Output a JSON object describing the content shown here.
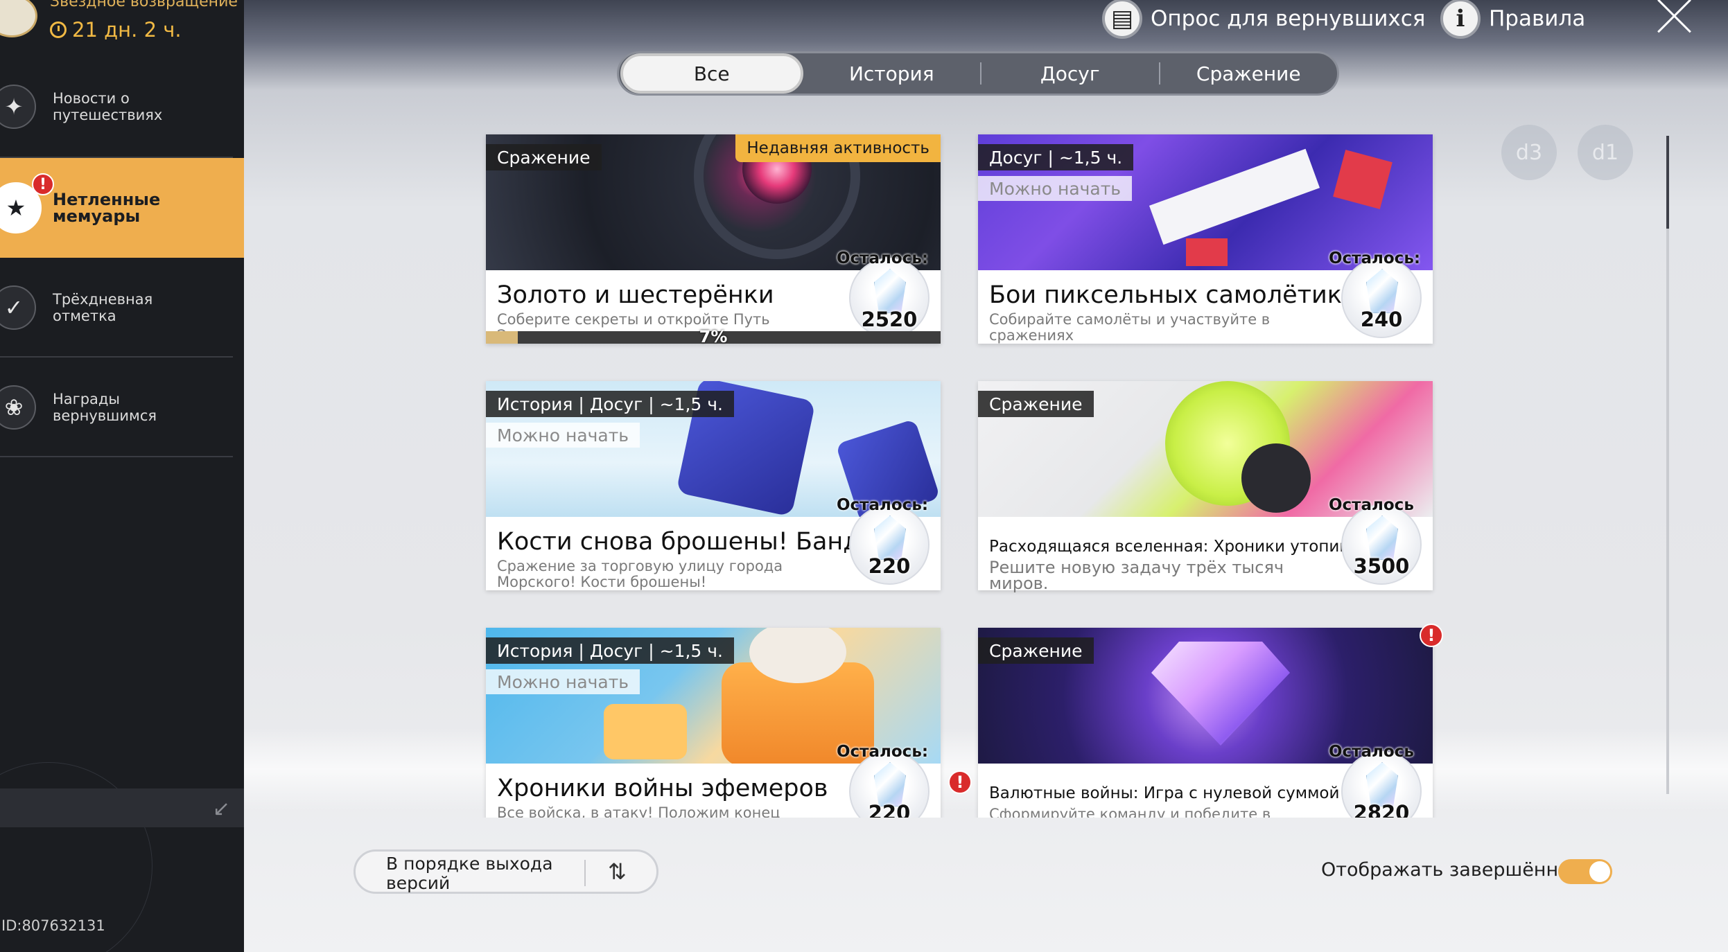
{
  "sidebar": {
    "event_title": "Звездное возвращение",
    "timer": "21 дн. 2 ч.",
    "items": [
      {
        "label": "Новости о путешествиях"
      },
      {
        "label": "Нетленные мемуары",
        "active": true
      },
      {
        "label": "Трёхдневная отметка"
      },
      {
        "label": "Награды вернувшимся"
      }
    ],
    "user_id": "ID:807632131"
  },
  "topbar": {
    "survey_label": "Опрос для вернувшихся",
    "rules_label": "Правила"
  },
  "tabs": [
    {
      "label": "Все",
      "selected": true
    },
    {
      "label": "История"
    },
    {
      "label": "Досуг"
    },
    {
      "label": "Сражение"
    }
  ],
  "cards": [
    {
      "tag": "Сражение",
      "recent": "Недавняя активность",
      "title": "Золото и шестерёнки",
      "desc": "Соберите секреты и откройте Путь Эрудиции.",
      "remain_label": "Осталось:",
      "amount": "2520",
      "progress_text": "7%",
      "progress": 0.07
    },
    {
      "tag": "Досуг | ~1,5 ч.",
      "status": "Можно начать",
      "title": "Бои пиксельных самолётиков",
      "desc": "Собирайте самолёты и участвуйте в сражениях",
      "remain_label": "Осталось:",
      "amount": "240"
    },
    {
      "tag": "История | Досуг | ~1,5 ч.",
      "status": "Можно начать",
      "title": "Кости снова брошены! Банда!",
      "desc": "Сражение за торговую улицу города Морского! Кости брошены!",
      "remain_label": "Осталось:",
      "amount": "220"
    },
    {
      "tag": "Сражение",
      "title": "Расходящаяся вселенная: Хроники утопии",
      "desc": "Решите новую задачу трёх тысяч миров.",
      "remain_label": "Осталось",
      "amount": "3500"
    },
    {
      "tag": "История | Досуг | ~1,5 ч.",
      "status": "Можно начать",
      "title": "Хроники войны эфемеров",
      "desc": "Все войска, в атаку! Положим конец смутным",
      "remain_label": "Осталось:",
      "amount": "220"
    },
    {
      "tag": "Сражение",
      "title": "Валютные войны: Игра с нулевой суммой",
      "desc": "Сформируйте команду и победите в",
      "remain_label": "Осталось",
      "amount": "2820"
    }
  ],
  "bottom": {
    "sort_label": "В порядке выхода версий",
    "show_completed_label": "Отображать завершённое",
    "show_completed": true
  },
  "colors": {
    "accent": "#efae4e",
    "sidebar_bg": "#1b1d21",
    "alert": "#d92b2b"
  },
  "icons": {
    "survey": "clipboard-icon",
    "rules": "info-icon",
    "close": "close-icon",
    "sort": "sort-arrows-icon"
  }
}
